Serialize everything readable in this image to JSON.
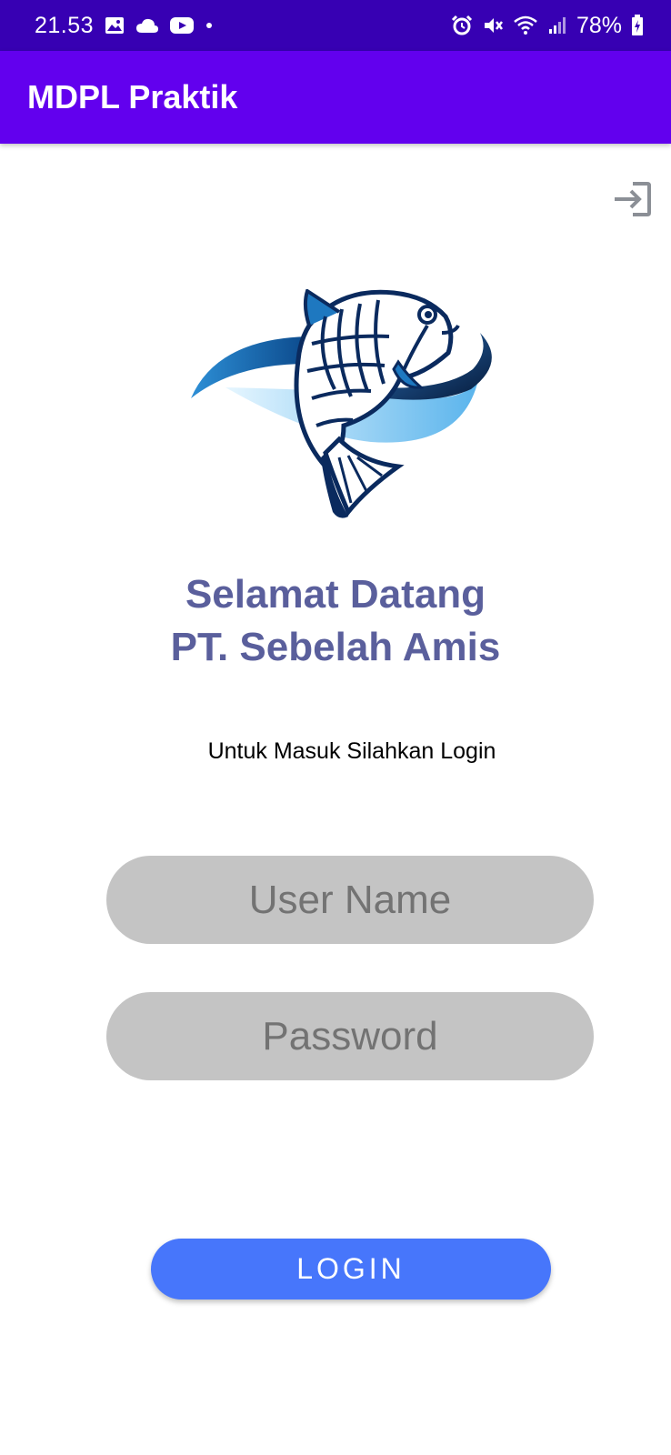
{
  "status_bar": {
    "time": "21.53",
    "battery": "78%",
    "left_icons": [
      "gallery-icon",
      "cloud-icon",
      "youtube-icon",
      "dot-icon"
    ],
    "right_icons": [
      "alarm-icon",
      "mute-icon",
      "wifi-icon",
      "signal-icon",
      "battery-icon"
    ]
  },
  "app_bar": {
    "title": "MDPL Praktik"
  },
  "header": {
    "logout_icon": "logout-icon"
  },
  "logo": {
    "name": "fish-logo",
    "colors": [
      "#0a2a5e",
      "#1e78c0",
      "#8fd0f5"
    ]
  },
  "welcome": {
    "line1": "Selamat Datang",
    "line2": "PT. Sebelah Amis"
  },
  "subtitle": "Untuk Masuk Silahkan Login",
  "form": {
    "username": {
      "value": "",
      "placeholder": "User Name"
    },
    "password": {
      "value": "",
      "placeholder": "Password"
    }
  },
  "login_button": "LOGIN",
  "colors": {
    "status_bar": "#3700b3",
    "app_bar": "#6200ee",
    "welcome_text": "#5a5f9c",
    "field_bg": "#c4c4c4",
    "button": "#4776fb"
  }
}
